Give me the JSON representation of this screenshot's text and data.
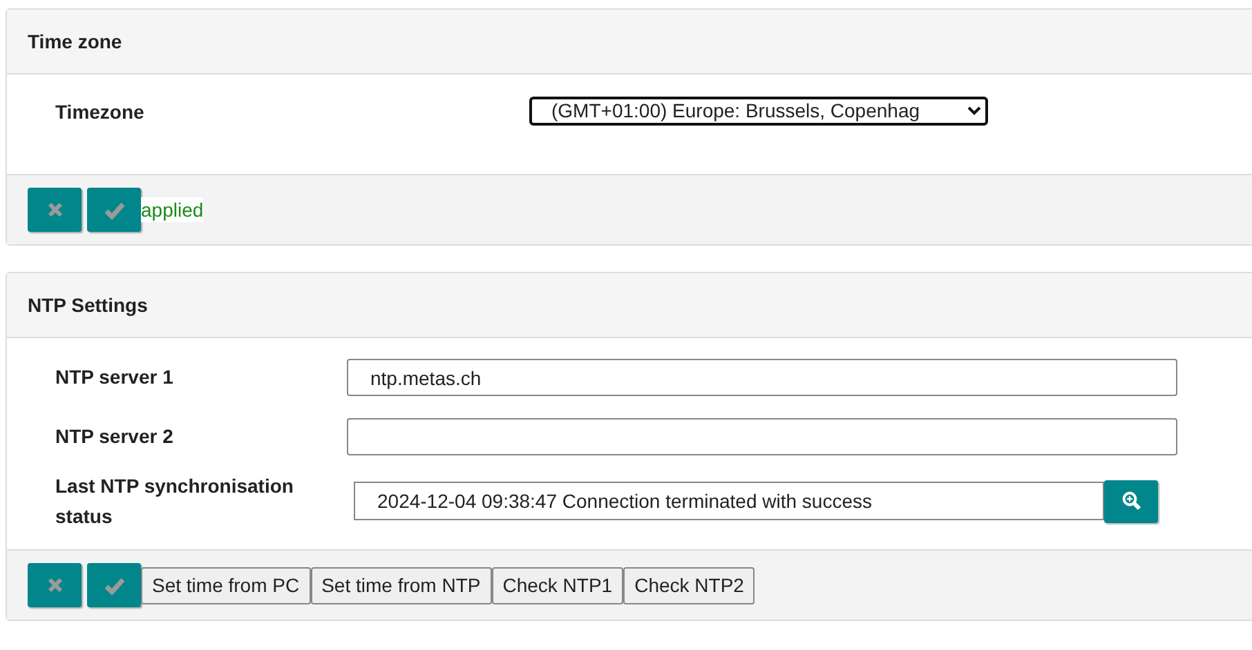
{
  "panels": [
    {
      "title": "Time zone",
      "fields": [
        {
          "kind": "select",
          "label": "Timezone",
          "value": "(GMT+01:00) Europe: Brussels, Copenhag"
        }
      ],
      "status": "applied"
    },
    {
      "title": "NTP Settings",
      "fields": [
        {
          "kind": "text",
          "label": "NTP server 1",
          "value": "ntp.metas.ch"
        },
        {
          "kind": "text",
          "label": "NTP server 2"
        },
        {
          "kind": "status",
          "label": "Last NTP synchronisation status",
          "value": "2024-12-04 09:38:47 Connection terminated with success"
        }
      ],
      "buttons": [
        "Set time from PC",
        "Set time from NTP",
        "Check NTP1",
        "Check NTP2"
      ]
    }
  ]
}
